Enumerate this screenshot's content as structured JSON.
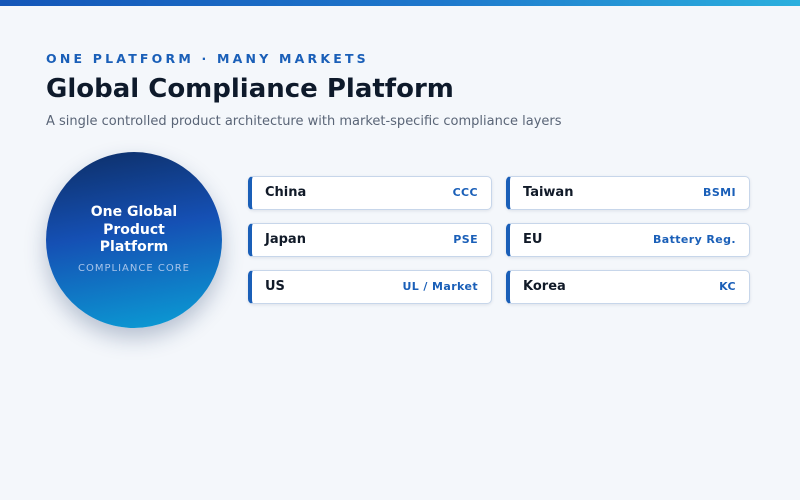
{
  "header": {
    "eyebrow": "ONE PLATFORM · MANY MARKETS",
    "title": "Global Compliance Platform",
    "subtitle": "A single controlled product architecture with market-specific compliance layers"
  },
  "core": {
    "title": "One Global\nProduct\nPlatform",
    "caption": "COMPLIANCE CORE"
  },
  "markets": [
    {
      "name": "China",
      "cert": "CCC"
    },
    {
      "name": "Taiwan",
      "cert": "BSMI"
    },
    {
      "name": "Japan",
      "cert": "PSE"
    },
    {
      "name": "EU",
      "cert": "Battery Reg."
    },
    {
      "name": "US",
      "cert": "UL / Market"
    },
    {
      "name": "Korea",
      "cert": "KC"
    }
  ],
  "colors": {
    "accent": "#1a5fb8",
    "title": "#0e1a2b",
    "background": "#f4f7fb"
  }
}
